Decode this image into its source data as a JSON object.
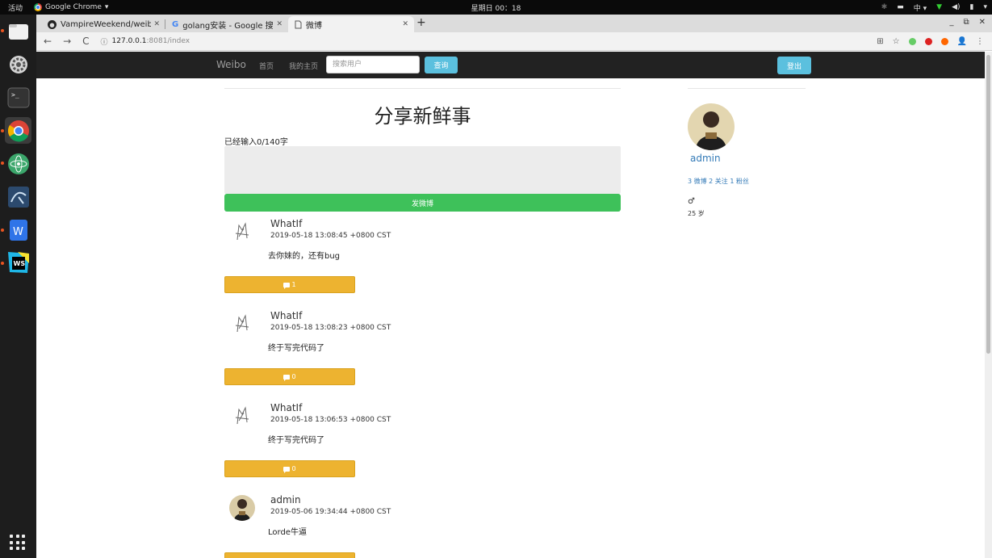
{
  "topbar": {
    "activities": "活动",
    "app_name": "Google Chrome",
    "clock": "星期日 00：18",
    "input_method": "中"
  },
  "browser": {
    "tabs": [
      {
        "title": "VampireWeekend/weibo",
        "icon": "github-icon"
      },
      {
        "title": "golang安装 - Google 搜索",
        "icon": "google-icon"
      },
      {
        "title": "微博",
        "icon": "page-icon"
      }
    ],
    "url_host": "127.0.0.1",
    "url_path": ":8081/index"
  },
  "navbar": {
    "brand": "Weibo",
    "home": "首页",
    "my_page": "我的主页",
    "search_placeholder": "搜索用户",
    "search_button": "查询",
    "logout_button": "登出"
  },
  "composer": {
    "title": "分享新鲜事",
    "counter": "已经输入0/140字",
    "submit": "发微博"
  },
  "posts": [
    {
      "author": "WhatIf",
      "time": "2019-05-18 13:08:45 +0800 CST",
      "content": "去你妹的，还有bug",
      "comments": "1",
      "avatar": "sketch-avatar"
    },
    {
      "author": "WhatIf",
      "time": "2019-05-18 13:08:23 +0800 CST",
      "content": "终于写完代码了",
      "comments": "0",
      "avatar": "sketch-avatar"
    },
    {
      "author": "WhatIf",
      "time": "2019-05-18 13:06:53 +0800 CST",
      "content": "终于写完代码了",
      "comments": "0",
      "avatar": "sketch-avatar"
    },
    {
      "author": "admin",
      "time": "2019-05-06 19:34:44 +0800 CST",
      "content": "Lorde牛逼",
      "comments": "",
      "avatar": "photo-avatar"
    }
  ],
  "profile": {
    "name": "admin",
    "stats": "3 微博  2 关注  1 粉丝",
    "gender": "♂",
    "age": "25 岁"
  }
}
